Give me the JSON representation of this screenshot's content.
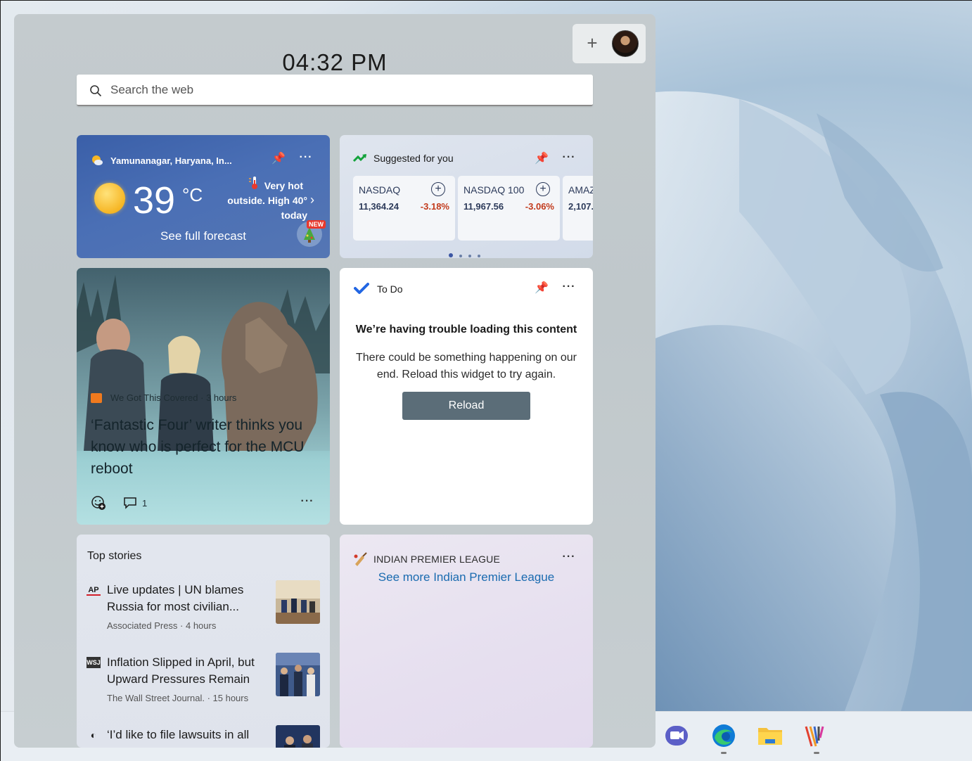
{
  "clock": "04:32 PM",
  "search": {
    "placeholder": "Search the web"
  },
  "weather": {
    "location": "Yamunanagar, Haryana, In...",
    "temperature": "39",
    "unit": "°C",
    "description_line1": "Very hot",
    "description_line2": "outside. High 40°",
    "description_line3": "today",
    "forecast_link": "See full forecast",
    "badge": "NEW"
  },
  "stocks": {
    "title": "Suggested for you",
    "items": [
      {
        "name": "NASDAQ",
        "value": "11,364.24",
        "change": "-3.18%"
      },
      {
        "name": "NASDAQ 100",
        "value": "11,967.56",
        "change": "-3.06%"
      },
      {
        "name": "AMAZ",
        "value": "2,107."
      }
    ],
    "page_count": 4,
    "active_page": 1
  },
  "news": {
    "source": "We Got This Covered · 3 hours",
    "headline": "‘Fantastic Four’ writer thinks you know who is perfect for the MCU reboot",
    "comment_count": "1"
  },
  "todo": {
    "title": "To Do",
    "heading": "We’re having trouble loading this content",
    "message": "There could be something happening on our end. Reload this widget to try again.",
    "reload_label": "Reload"
  },
  "top_stories": {
    "title": "Top stories",
    "items": [
      {
        "logo": "AP",
        "title": "Live updates | UN blames Russia for most civilian...",
        "meta": "Associated Press · 4 hours"
      },
      {
        "logo": "WSJ",
        "title": "Inflation Slipped in April, but Upward Pressures Remain",
        "meta": "The Wall Street Journal. · 15 hours"
      },
      {
        "logo": "◐",
        "title": "‘I’d like to file lawsuits in all",
        "meta": ""
      }
    ]
  },
  "ipl": {
    "title": "INDIAN PREMIER LEAGUE",
    "link": "See more Indian Premier League"
  },
  "colors": {
    "weather_bg": "#3f63aa",
    "negative_change": "#c23a1c",
    "link": "#1a6bb0",
    "reload_button": "#5b6d78"
  }
}
